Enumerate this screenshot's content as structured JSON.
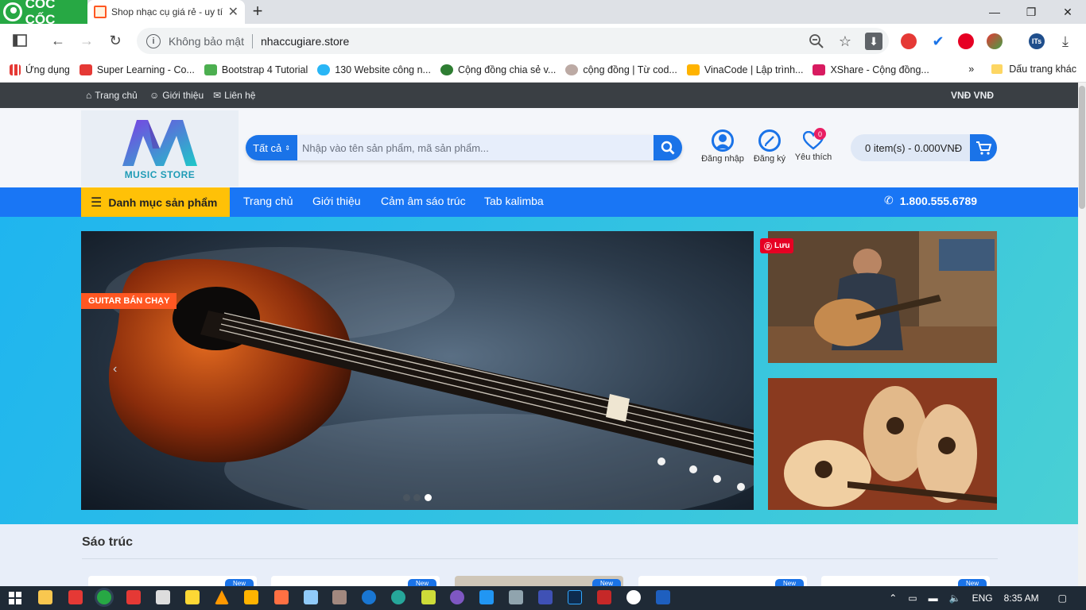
{
  "browser": {
    "brand": "CỐC CỐC",
    "tab_title": "Shop nhạc cụ giá rẻ - uy tí",
    "security_label": "Không bảo mật",
    "url": "nhaccugiare.store",
    "bookmarks": [
      "Ứng dụng",
      "Super Learning - Co...",
      "Bootstrap 4 Tutorial",
      "130 Website công n...",
      "Cộng đồng chia sẻ v...",
      "cộng đồng | Từ cod...",
      "VinaCode | Lập trình...",
      "XShare - Cộng đồng..."
    ],
    "bookmarks_more": "»",
    "other_bookmarks": "Dấu trang khác"
  },
  "topbar": {
    "links": [
      "Trang chủ",
      "Giới thiệu",
      "Liên hệ"
    ],
    "currency": "VNĐ VNĐ"
  },
  "header": {
    "logo_text": "MUSIC STORE",
    "category_select": "Tất cả",
    "search_placeholder": "Nhập vào tên sản phẩm, mã sản phẩm...",
    "login": "Đăng nhập",
    "register": "Đăng ký",
    "wishlist": "Yêu thích",
    "wishlist_count": "0",
    "cart": "0 item(s) - 0.000VNĐ"
  },
  "nav": {
    "category_menu": "Danh mục sản phẩm",
    "links": [
      "Trang chủ",
      "Giới thiệu",
      "Cảm âm sáo trúc",
      "Tab kalimba"
    ],
    "phone": "1.800.555.6789"
  },
  "hero": {
    "slide_badge": "GUITAR BÁN CHẠY",
    "pinterest_save": "Lưu",
    "active_slide": 3,
    "slide_count": 3
  },
  "section": {
    "title": "Sáo trúc",
    "new_tag": "New"
  },
  "taskbar": {
    "lang": "ENG",
    "time": "8:35 AM"
  }
}
